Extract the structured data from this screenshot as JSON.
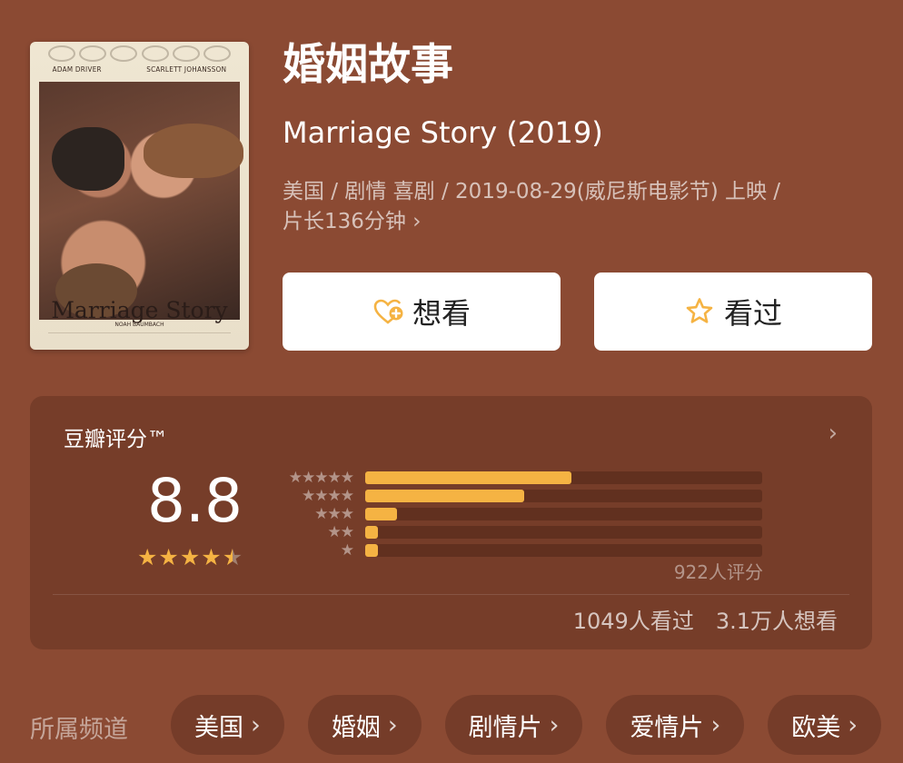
{
  "movie": {
    "title_cn": "婚姻故事",
    "title_en": "Marriage Story (2019)",
    "meta_line1": "美国 / 剧情 喜剧 / 2019-08-29(威尼斯电影节) 上映 /",
    "meta_line2": "片长136分钟 ›"
  },
  "poster": {
    "credit_left": "ADAM DRIVER",
    "credit_right": "SCARLETT JOHANSSON",
    "title": "Marriage Story",
    "director": "NOAH BAUMBACH"
  },
  "actions": {
    "want_label": "想看",
    "want_icon": "heart-plus-icon",
    "seen_label": "看过",
    "seen_icon": "star-outline-icon",
    "accent": "#f5b343"
  },
  "rating": {
    "title": "豆瓣评分™",
    "score": "8.8",
    "stars_value": 4.5,
    "distribution": [
      {
        "stars": 5,
        "stars_text": "★★★★★",
        "fraction": 0.52
      },
      {
        "stars": 4,
        "stars_text": "★★★★",
        "fraction": 0.4
      },
      {
        "stars": 3,
        "stars_text": "★★★",
        "fraction": 0.08
      },
      {
        "stars": 2,
        "stars_text": "★★",
        "fraction": 0.03
      },
      {
        "stars": 1,
        "stars_text": "★",
        "fraction": 0.03
      }
    ],
    "count": "922人评分",
    "seen": "1049人看过",
    "want": "3.1万人想看",
    "star_color": "#f5b343"
  },
  "channels": {
    "label": "所属频道",
    "items": [
      "美国",
      "婚姻",
      "剧情片",
      "爱情片",
      "欧美"
    ]
  }
}
